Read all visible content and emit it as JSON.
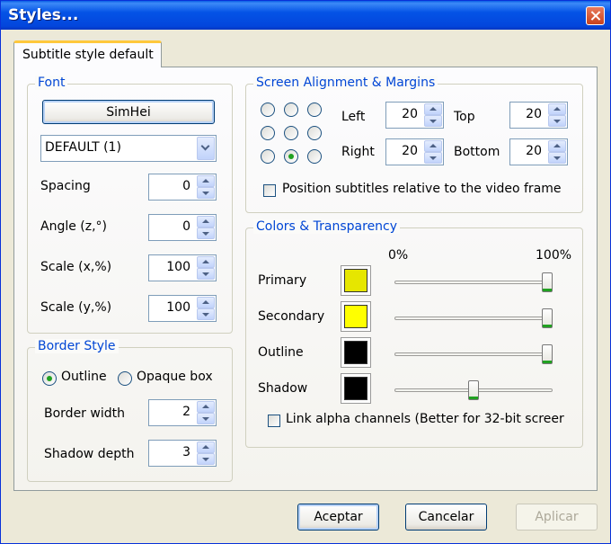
{
  "window": {
    "title": "Styles..."
  },
  "tab": {
    "label": "Subtitle style default"
  },
  "font": {
    "group_title": "Font",
    "font_button": "SimHei",
    "charset_value": "DEFAULT (1)",
    "spacing": {
      "label": "Spacing",
      "value": "0"
    },
    "angle": {
      "label": "Angle (z,°)",
      "value": "0"
    },
    "scale_x": {
      "label": "Scale (x,%)",
      "value": "100"
    },
    "scale_y": {
      "label": "Scale (y,%)",
      "value": "100"
    }
  },
  "border": {
    "group_title": "Border Style",
    "outline_label": "Outline",
    "opaque_label": "Opaque box",
    "selected": "outline",
    "width": {
      "label": "Border width",
      "value": "2"
    },
    "shadow": {
      "label": "Shadow depth",
      "value": "3"
    }
  },
  "alignment": {
    "group_title": "Screen Alignment & Margins",
    "selected_position": "bottom-center",
    "left": {
      "label": "Left",
      "value": "20"
    },
    "top": {
      "label": "Top",
      "value": "20"
    },
    "right": {
      "label": "Right",
      "value": "20"
    },
    "bottom": {
      "label": "Bottom",
      "value": "20"
    },
    "relative_label": "Position subtitles relative to the video frame",
    "relative_checked": false
  },
  "colors": {
    "group_title": "Colors & Transparency",
    "scale_min": "0%",
    "scale_max": "100%",
    "rows": [
      {
        "label": "Primary",
        "color": "#e6e600",
        "alpha": 1.0
      },
      {
        "label": "Secondary",
        "color": "#ffff00",
        "alpha": 1.0
      },
      {
        "label": "Outline",
        "color": "#000000",
        "alpha": 1.0
      },
      {
        "label": "Shadow",
        "color": "#000000",
        "alpha": 0.5
      }
    ],
    "link_label": "Link alpha channels (Better for 32-bit screer",
    "link_checked": false
  },
  "buttons": {
    "ok": "Aceptar",
    "cancel": "Cancelar",
    "apply": "Aplicar"
  }
}
